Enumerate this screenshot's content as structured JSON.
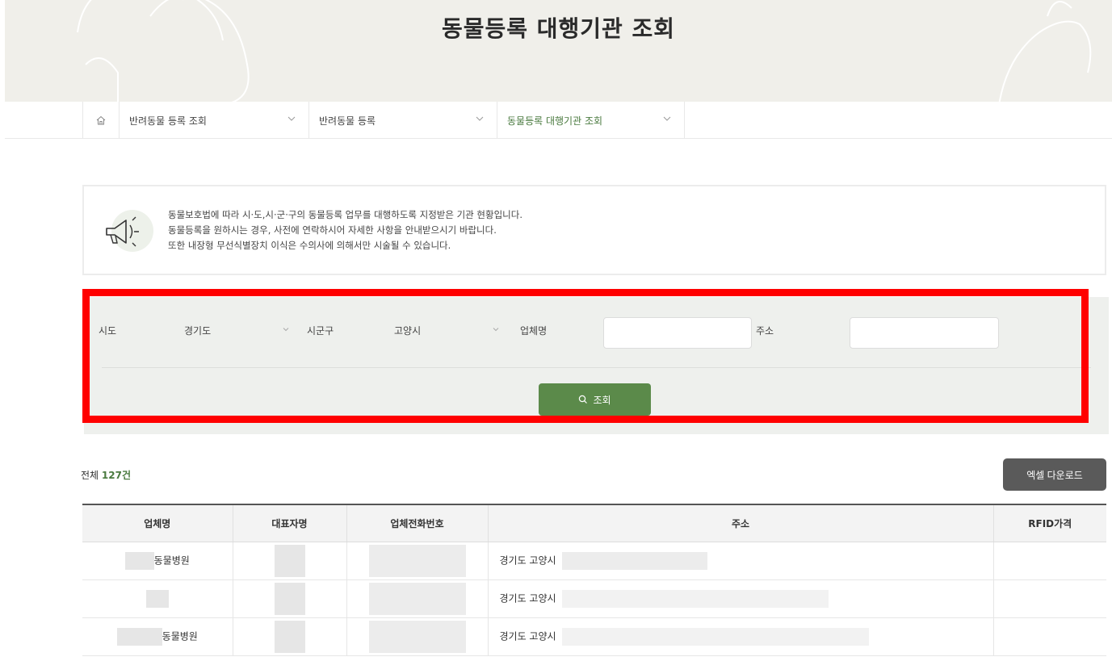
{
  "page": {
    "title": "동물등록 대행기관 조회"
  },
  "breadcrumb": {
    "items": [
      {
        "label": "반려동물 등록 조회"
      },
      {
        "label": "반려동물 등록"
      },
      {
        "label": "동물등록 대행기관 조회"
      }
    ]
  },
  "notice": {
    "lines": [
      "동물보호법에 따라 시·도,시·군·구의 동물등록 업무를 대행하도록 지정받은 기관 현황입니다.",
      "동물등록을 원하시는 경우, 사전에 연락하시어 자세한 사항을 안내받으시기 바랍니다.",
      "또한 내장형 무선식별장치 이식은 수의사에 의해서만 시술될 수 있습니다."
    ]
  },
  "search": {
    "sido_label": "시도",
    "sido_value": "경기도",
    "sigungu_label": "시군구",
    "sigungu_value": "고양시",
    "company_label": "업체명",
    "company_value": "",
    "address_label": "주소",
    "address_value": "",
    "button_label": "조회"
  },
  "results": {
    "total_prefix": "전체",
    "total_count": "127",
    "total_suffix": "건",
    "excel_label": "엑셀 다운로드",
    "columns": [
      "업체명",
      "대표자명",
      "업체전화번호",
      "주소",
      "RFID가격"
    ],
    "rows": [
      {
        "name": "동물병원",
        "address": "경기도 고양시"
      },
      {
        "name": "",
        "address": "경기도 고양시"
      },
      {
        "name": "동물병원",
        "address": "경기도 고양시"
      }
    ]
  },
  "colors": {
    "accent": "#5b8a4a",
    "highlight": "#ff0000",
    "excel": "#5a5a5a"
  },
  "icons": [
    "home-icon",
    "chevron-down-icon",
    "megaphone-icon",
    "search-icon"
  ]
}
